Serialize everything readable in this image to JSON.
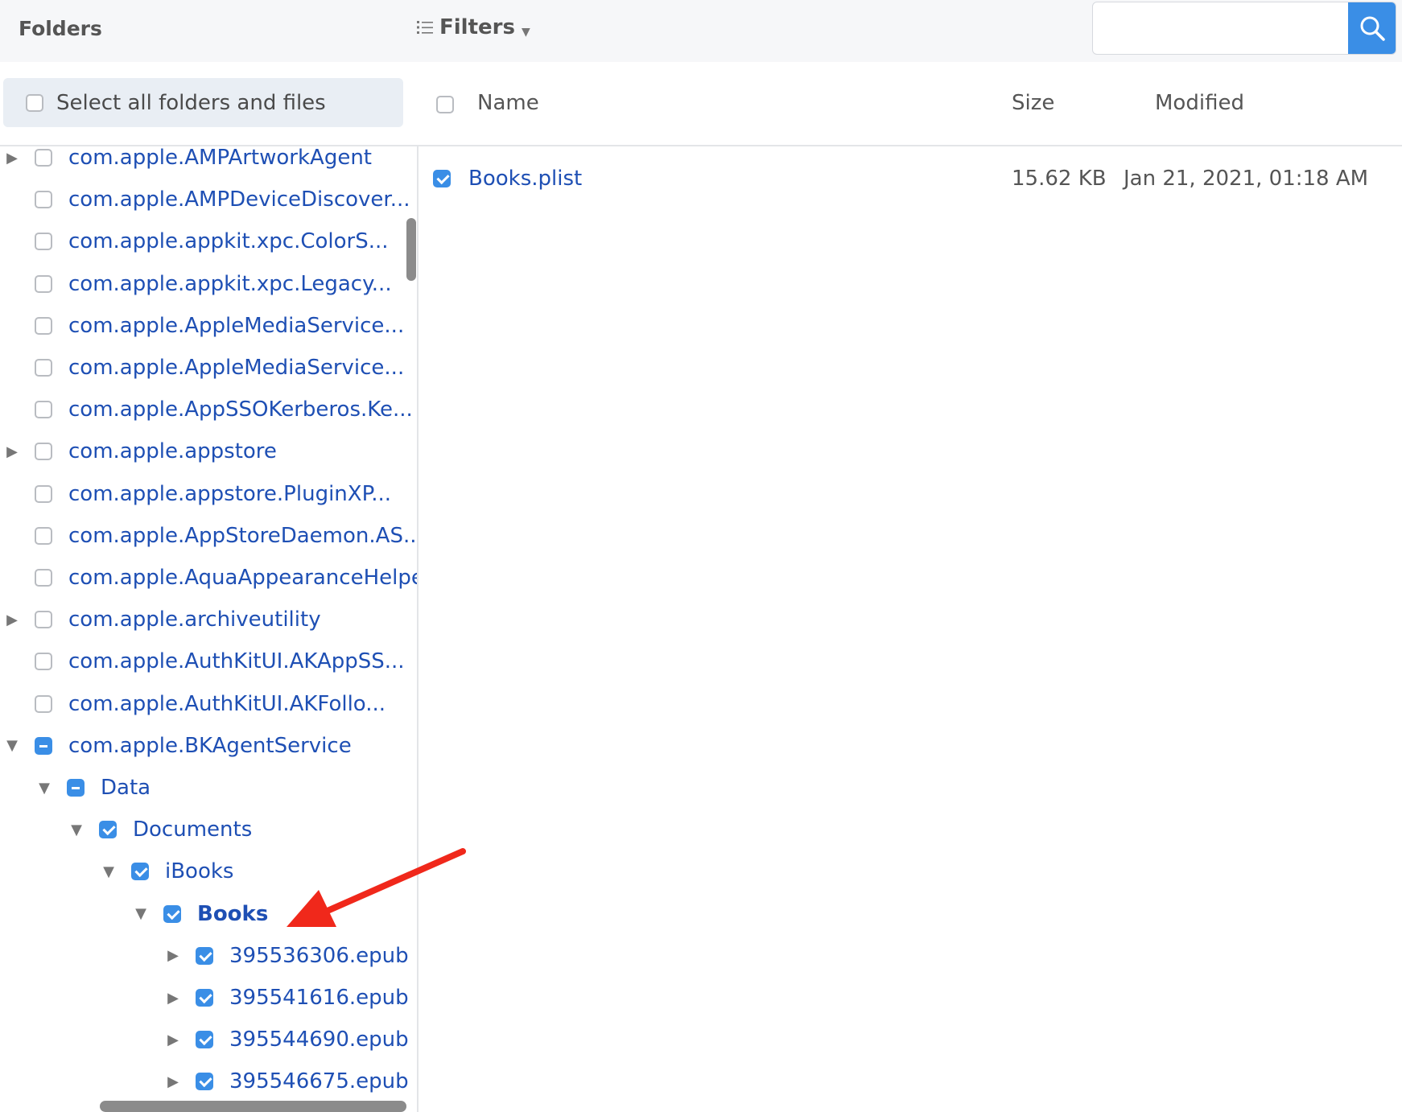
{
  "header": {
    "folders_title": "Folders",
    "filters_label": "Filters",
    "search": {
      "value": "",
      "placeholder": ""
    }
  },
  "select_all": {
    "label": "Select all folders and files",
    "checked": false
  },
  "columns": {
    "name": "Name",
    "size": "Size",
    "modified": "Modified"
  },
  "tree": [
    {
      "label": "com.apple.AMPArtworkAgent",
      "toggle": "collapsed",
      "state": "unchecked",
      "level": 0
    },
    {
      "label": "com.apple.AMPDeviceDiscover...",
      "toggle": "none",
      "state": "unchecked",
      "level": 0
    },
    {
      "label": "com.apple.appkit.xpc.ColorS...",
      "toggle": "none",
      "state": "unchecked",
      "level": 0
    },
    {
      "label": "com.apple.appkit.xpc.Legacy...",
      "toggle": "none",
      "state": "unchecked",
      "level": 0
    },
    {
      "label": "com.apple.AppleMediaService...",
      "toggle": "none",
      "state": "unchecked",
      "level": 0
    },
    {
      "label": "com.apple.AppleMediaService...",
      "toggle": "none",
      "state": "unchecked",
      "level": 0
    },
    {
      "label": "com.apple.AppSSOKerberos.Ke...",
      "toggle": "none",
      "state": "unchecked",
      "level": 0
    },
    {
      "label": "com.apple.appstore",
      "toggle": "collapsed",
      "state": "unchecked",
      "level": 0
    },
    {
      "label": "com.apple.appstore.PluginXP...",
      "toggle": "none",
      "state": "unchecked",
      "level": 0
    },
    {
      "label": "com.apple.AppStoreDaemon.AS...",
      "toggle": "none",
      "state": "unchecked",
      "level": 0
    },
    {
      "label": "com.apple.AquaAppearanceHelper",
      "toggle": "none",
      "state": "unchecked",
      "level": 0
    },
    {
      "label": "com.apple.archiveutility",
      "toggle": "collapsed",
      "state": "unchecked",
      "level": 0
    },
    {
      "label": "com.apple.AuthKitUI.AKAppSS...",
      "toggle": "none",
      "state": "unchecked",
      "level": 0
    },
    {
      "label": "com.apple.AuthKitUI.AKFollo...",
      "toggle": "none",
      "state": "unchecked",
      "level": 0
    },
    {
      "label": "com.apple.BKAgentService",
      "toggle": "expanded",
      "state": "partial",
      "level": 0
    },
    {
      "label": "Data",
      "toggle": "expanded",
      "state": "partial",
      "level": 1
    },
    {
      "label": "Documents",
      "toggle": "expanded",
      "state": "checked",
      "level": 2
    },
    {
      "label": "iBooks",
      "toggle": "expanded",
      "state": "checked",
      "level": 3
    },
    {
      "label": "Books",
      "toggle": "expanded",
      "state": "checked",
      "level": 4,
      "selected": true
    },
    {
      "label": "395536306.epub",
      "toggle": "collapsed",
      "state": "checked",
      "level": 5
    },
    {
      "label": "395541616.epub",
      "toggle": "collapsed",
      "state": "checked",
      "level": 5
    },
    {
      "label": "395544690.epub",
      "toggle": "collapsed",
      "state": "checked",
      "level": 5
    },
    {
      "label": "395546675.epub",
      "toggle": "collapsed",
      "state": "checked",
      "level": 5
    }
  ],
  "files": [
    {
      "name": "Books.plist",
      "size": "15.62 KB",
      "modified": "Jan 21, 2021, 01:18 AM",
      "checked": true
    }
  ],
  "colors": {
    "accent": "#3a8ee6",
    "link": "#1e4fb4",
    "annotation_arrow": "#f0281b"
  },
  "icons": {
    "filters": "list-icon",
    "search": "search-icon",
    "collapsed": "triangle-right-icon",
    "expanded": "triangle-down-icon",
    "annotation": "red-arrow-icon"
  }
}
